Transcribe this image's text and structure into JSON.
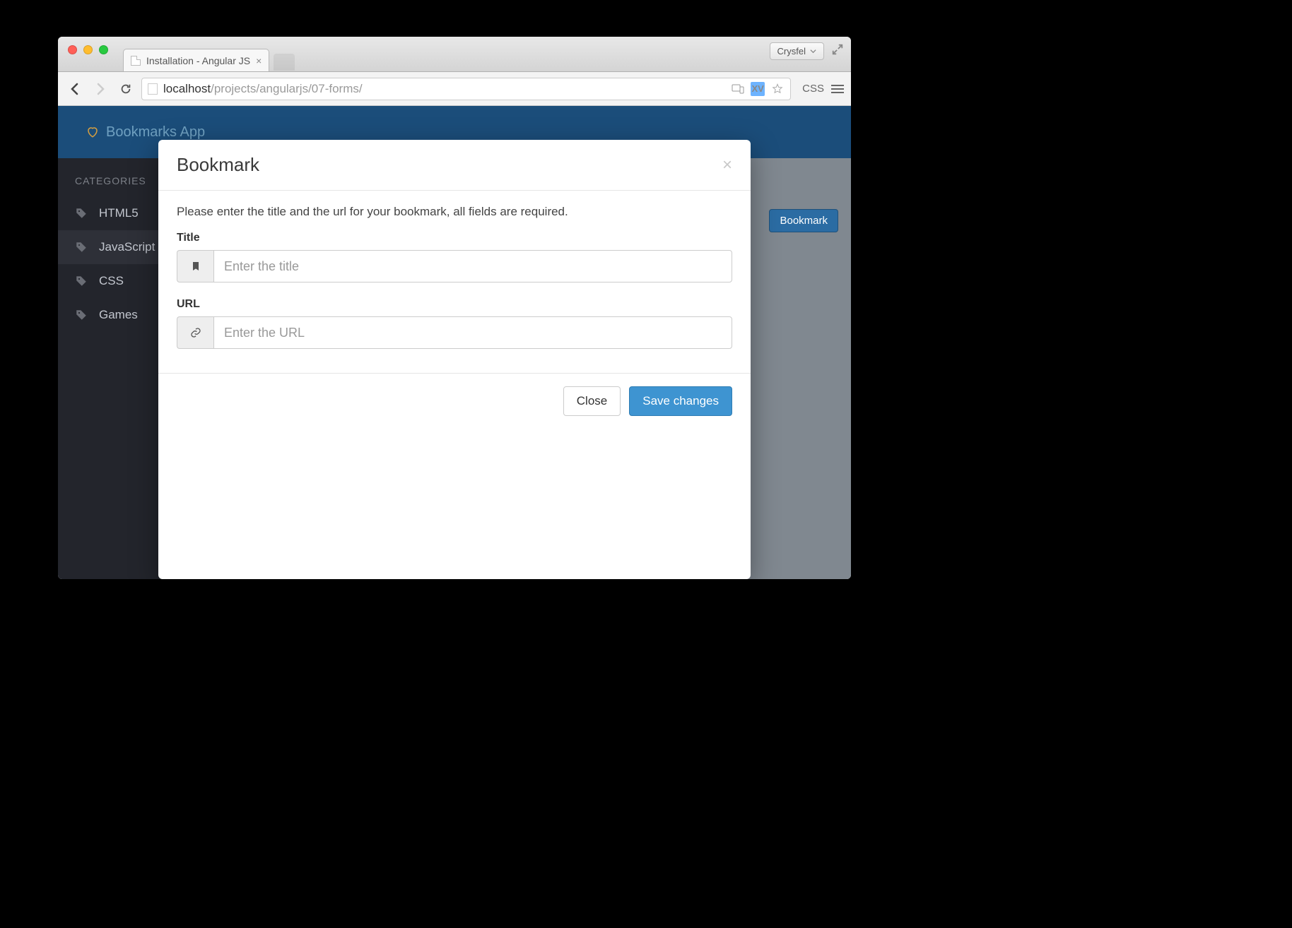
{
  "browser": {
    "tab_title": "Installation - Angular JS",
    "profile_label": "Crysfel",
    "url_host": "localhost",
    "url_path": "/projects/angularjs/07-forms/",
    "css_label": "CSS"
  },
  "app": {
    "brand": "Bookmarks App",
    "sidebar_title": "CATEGORIES",
    "categories": [
      {
        "label": "HTML5",
        "active": false
      },
      {
        "label": "JavaScript",
        "active": true
      },
      {
        "label": "CSS",
        "active": false
      },
      {
        "label": "Games",
        "active": false
      }
    ],
    "add_bookmark_label": "Bookmark"
  },
  "modal": {
    "title": "Bookmark",
    "description": "Please enter the title and the url for your bookmark, all fields are required.",
    "title_label": "Title",
    "title_placeholder": "Enter the title",
    "url_label": "URL",
    "url_placeholder": "Enter the URL",
    "close_label": "Close",
    "save_label": "Save changes"
  }
}
